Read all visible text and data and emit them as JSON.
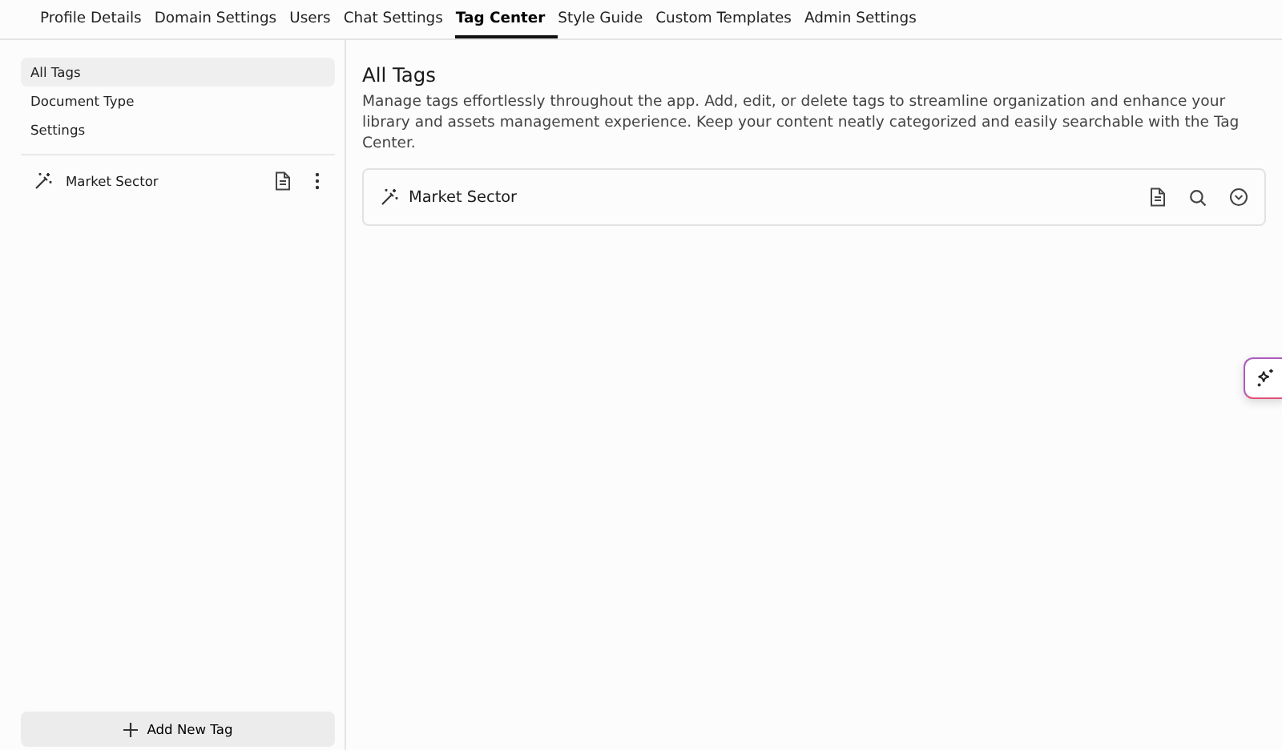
{
  "tabs": [
    {
      "label": "Profile Details",
      "selected": false
    },
    {
      "label": "Domain Settings",
      "selected": false
    },
    {
      "label": "Users",
      "selected": false
    },
    {
      "label": "Chat Settings",
      "selected": false
    },
    {
      "label": "Tag Center",
      "selected": true
    },
    {
      "label": "Style Guide",
      "selected": false
    },
    {
      "label": "Custom Templates",
      "selected": false
    },
    {
      "label": "Admin Settings",
      "selected": false
    }
  ],
  "sidebar": {
    "items": [
      {
        "label": "All Tags",
        "selected": true
      },
      {
        "label": "Document Type",
        "selected": false
      },
      {
        "label": "Settings",
        "selected": false
      }
    ],
    "tags": [
      {
        "label": "Market Sector"
      }
    ],
    "add_button": "Add New Tag"
  },
  "main": {
    "title": "All Tags",
    "description": "Manage tags effortlessly throughout the app. Add, edit, or delete tags to streamline organization and enhance your library and assets management experience. Keep your content neatly categorized and easily searchable with the Tag Center.",
    "tags": [
      {
        "label": "Market Sector"
      }
    ]
  }
}
